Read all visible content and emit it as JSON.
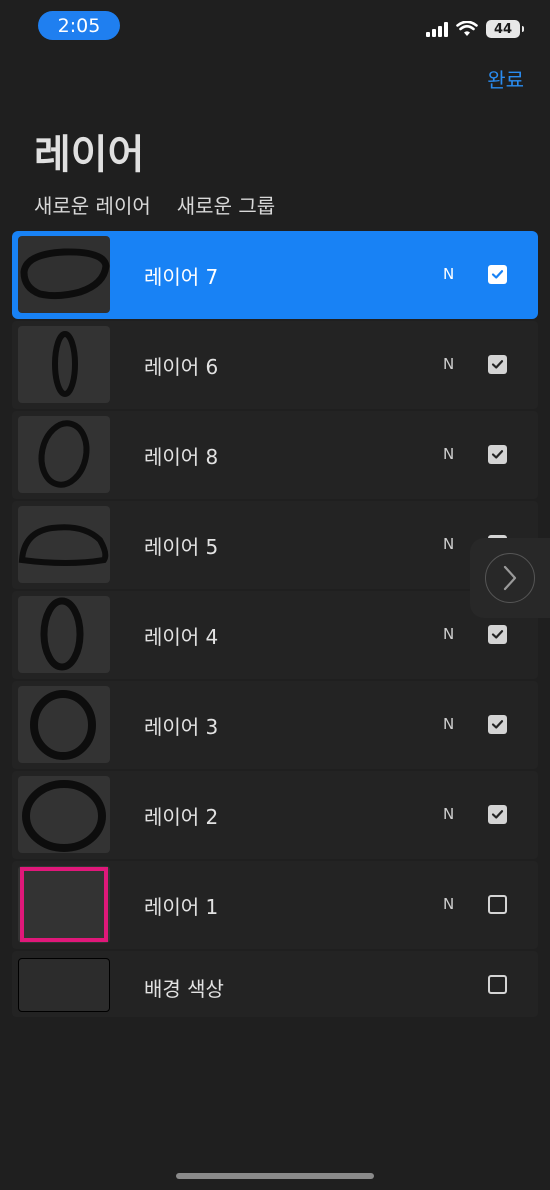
{
  "status": {
    "time": "2:05",
    "battery": "44"
  },
  "header": {
    "done_label": "완료",
    "title": "레이어"
  },
  "actions": {
    "new_layer": "새로운 레이어",
    "new_group": "새로운 그룹"
  },
  "layers": [
    {
      "name": "레이어 7",
      "blend": "N",
      "visible": true,
      "selected": true
    },
    {
      "name": "레이어 6",
      "blend": "N",
      "visible": true,
      "selected": false
    },
    {
      "name": "레이어 8",
      "blend": "N",
      "visible": true,
      "selected": false
    },
    {
      "name": "레이어 5",
      "blend": "N",
      "visible": true,
      "selected": false
    },
    {
      "name": "레이어 4",
      "blend": "N",
      "visible": true,
      "selected": false
    },
    {
      "name": "레이어 3",
      "blend": "N",
      "visible": true,
      "selected": false
    },
    {
      "name": "레이어 2",
      "blend": "N",
      "visible": true,
      "selected": false
    },
    {
      "name": "레이어 1",
      "blend": "N",
      "visible": false,
      "selected": false
    }
  ],
  "background": {
    "name": "배경 색상",
    "visible": false
  },
  "colors": {
    "accent": "#1882f5",
    "link": "#2a8cf0",
    "layer1_border": "#e0187a"
  }
}
